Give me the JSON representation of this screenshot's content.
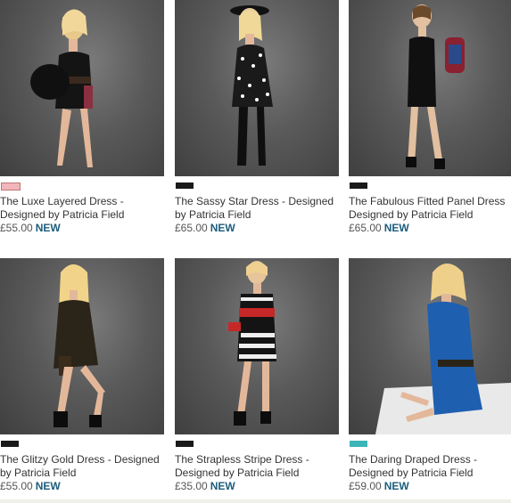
{
  "products": [
    {
      "title": "The Luxe Layered Dress - Designed by Patricia Field",
      "price": "£55.00",
      "badge": "NEW",
      "swatch": "#f2b5b9"
    },
    {
      "title": "The Sassy Star Dress - Designed by Patricia Field",
      "price": "£65.00",
      "badge": "NEW",
      "swatch": "#1a1a1a"
    },
    {
      "title": "The Fabulous Fitted Panel Dress Designed by Patricia Field",
      "price": "£65.00",
      "badge": "NEW",
      "swatch": "#1a1a1a"
    },
    {
      "title": "The Glitzy Gold Dress - Designed by Patricia Field",
      "price": "£55.00",
      "badge": "NEW",
      "swatch": "#1a1a1a"
    },
    {
      "title": "The Strapless Stripe Dress - Designed by Patricia Field",
      "price": "£35.00",
      "badge": "NEW",
      "swatch": "#1a1a1a"
    },
    {
      "title": "The Daring Draped Dress - Designed by Patricia Field",
      "price": "£59.00",
      "badge": "NEW",
      "swatch": "#3bb5b8"
    }
  ],
  "colors": {
    "badge": "#1b5d7c",
    "text": "#333333"
  }
}
